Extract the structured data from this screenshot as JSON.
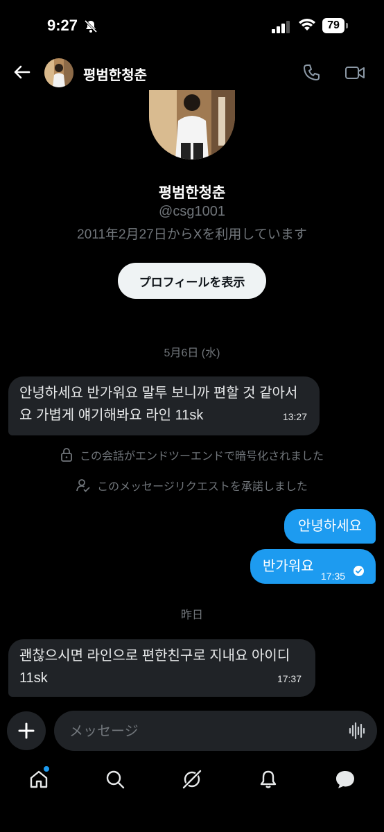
{
  "status": {
    "time": "9:27",
    "battery": "79"
  },
  "header": {
    "name": "평범한청춘"
  },
  "profile": {
    "name": "평범한청춘",
    "handle": "@csg1001",
    "joined": "2011年2月27日からXを利用しています",
    "view_profile_label": "プロフィールを表示"
  },
  "conversation": {
    "date1": "5月6日 (水)",
    "msg1": {
      "line1": "안녕하세요 반가워요 말투 보니까 편할 것 같아서",
      "line2": "요 가볍게 얘기해봐요 라인 11sk",
      "time": "13:27"
    },
    "encrypted_note": "この会話がエンドツーエンドで暗号化されました",
    "accepted_note": "このメッセージリクエストを承諾しました",
    "msg2": {
      "text": "안녕하세요"
    },
    "msg3": {
      "text": "반가워요",
      "time": "17:35"
    },
    "date2": "昨日",
    "msg4": {
      "line1": "괜찮으시면 라인으로 편한친구로 지내요 아이디",
      "line2": "11sk",
      "time": "17:37"
    }
  },
  "composer": {
    "placeholder": "メッセージ"
  },
  "colors": {
    "accent": "#1d9bf0",
    "bubble_in": "#202327",
    "muted": "#71767b"
  },
  "tabs": [
    "home-icon",
    "search-icon",
    "grok-icon",
    "bell-icon",
    "messages-icon"
  ]
}
